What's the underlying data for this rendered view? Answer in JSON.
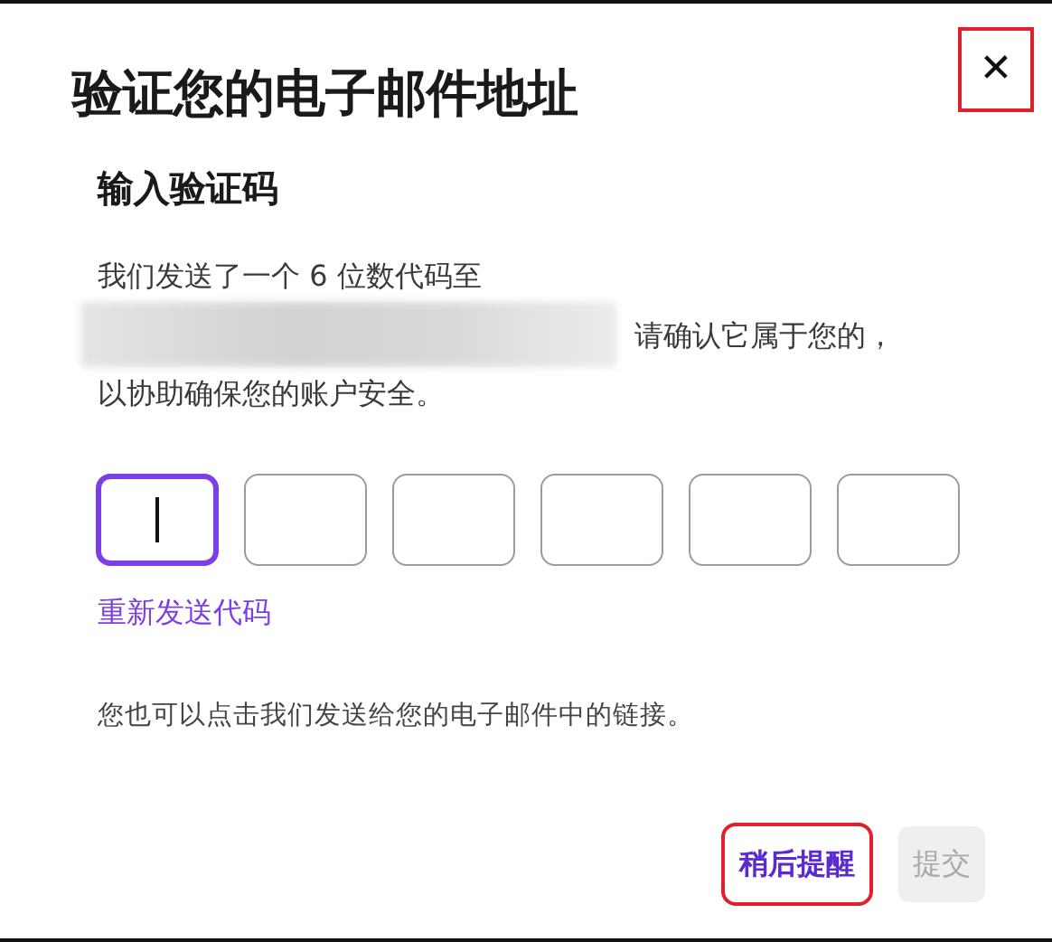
{
  "dialog": {
    "title": "验证您的电子邮件地址",
    "close": {
      "label": "✕",
      "highlighted": true
    }
  },
  "section_title": "输入验证码",
  "message": {
    "line_1": "我们发送了一个 6 位数代码至",
    "line_2": "请确认它属于您的，",
    "line_3": "以协助确保您的账户安全。"
  },
  "code_boxes": [
    {
      "focused": true
    },
    {
      "focused": false
    },
    {
      "focused": false
    },
    {
      "focused": false
    },
    {
      "focused": false
    },
    {
      "focused": false
    }
  ],
  "resend_link": "重新发送代码",
  "hint": "您也可以点击我们发送给您的电子邮件中的链接。",
  "buttons": [
    {
      "kind": "text",
      "label": "稍后提醒",
      "highlighted": true,
      "disabled": false
    },
    {
      "kind": "filled",
      "label": "提交",
      "highlighted": false,
      "disabled": true
    }
  ]
}
